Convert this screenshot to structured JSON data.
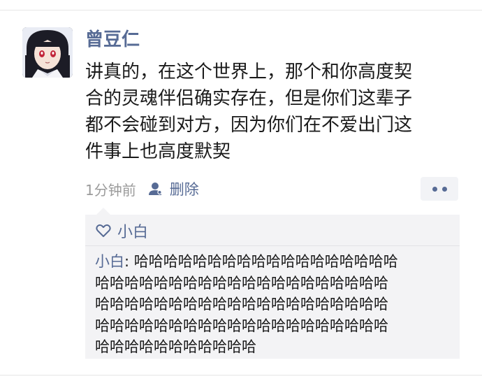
{
  "post": {
    "username": "曾豆仁",
    "text_lines": [
      "讲真的，在这个世界上，那个和你高度契",
      "合的灵魂伴侣确实存在，但是你们这辈子",
      "都不会碰到对方，因为你们在不爱出门这",
      "件事上也高度默契"
    ],
    "time": "1分钟前",
    "delete_label": "删除",
    "icons": {
      "visibility": "person-icon",
      "more": "more-dots-icon"
    }
  },
  "likes": {
    "icon": "heart-icon",
    "names": "小白"
  },
  "comment": {
    "commenter": "小白",
    "separator": ": ",
    "first_line_text": "哈哈哈哈哈哈哈哈哈哈哈哈哈哈哈哈哈哈",
    "continuation_lines": [
      "哈哈哈哈哈哈哈哈哈哈哈哈哈哈哈哈哈哈哈哈",
      "哈哈哈哈哈哈哈哈哈哈哈哈哈哈哈哈哈哈哈哈",
      "哈哈哈哈哈哈哈哈哈哈哈哈哈哈哈哈哈哈哈哈",
      "哈哈哈哈哈哈哈哈哈哈哈"
    ]
  },
  "colors": {
    "link": "#576b95",
    "text": "#1a1a1a",
    "meta": "#9b9b9b",
    "comment_bg": "#f3f3f5"
  }
}
